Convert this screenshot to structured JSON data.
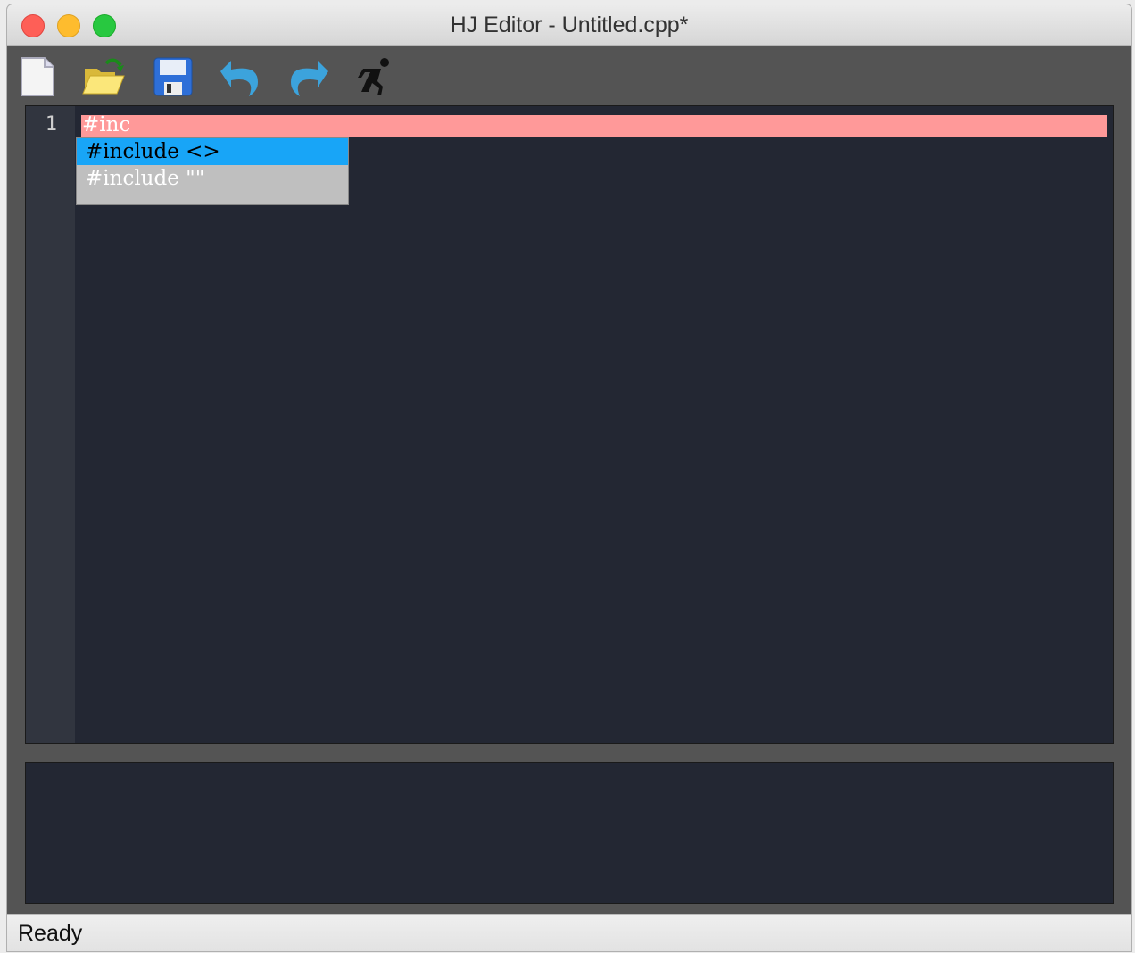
{
  "window": {
    "title": "HJ Editor - Untitled.cpp*"
  },
  "toolbar": {
    "buttons": [
      {
        "name": "new-file",
        "icon": "new-file-icon"
      },
      {
        "name": "open-file",
        "icon": "open-folder-icon"
      },
      {
        "name": "save-file",
        "icon": "floppy-disk-icon"
      },
      {
        "name": "undo",
        "icon": "undo-arrow-icon"
      },
      {
        "name": "redo",
        "icon": "redo-arrow-icon"
      },
      {
        "name": "run",
        "icon": "running-man-icon"
      }
    ]
  },
  "editor": {
    "line_numbers": [
      "1"
    ],
    "lines": [
      "#inc"
    ],
    "current_line_color": "#ff9999"
  },
  "autocomplete": {
    "items": [
      "#include <>",
      "#include \"\""
    ],
    "selected_index": 0,
    "selected_color": "#18a5f7"
  },
  "status": {
    "text": "Ready"
  }
}
